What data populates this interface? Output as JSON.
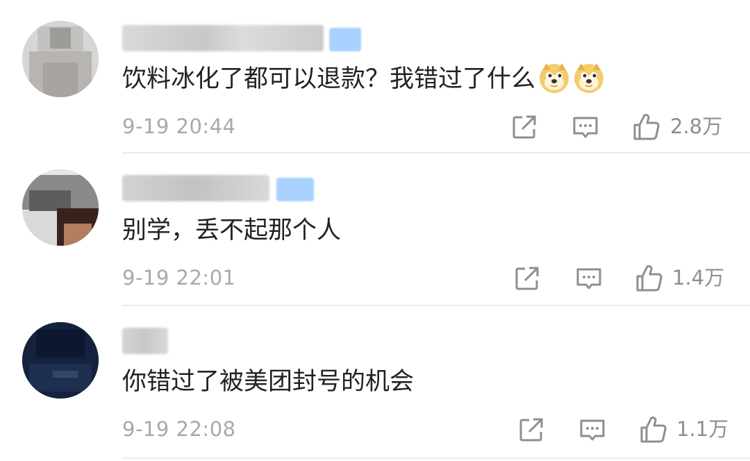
{
  "comments": [
    {
      "text": "饮料冰化了都可以退款？我错过了什么",
      "emoji": [
        "doge-emoji",
        "doge-emoji"
      ],
      "timestamp": "9-19 20:44",
      "likes": "2.8万"
    },
    {
      "text": "别学，丢不起那个人",
      "emoji": [],
      "timestamp": "9-19 22:01",
      "likes": "1.4万"
    },
    {
      "text": "你错过了被美团封号的机会",
      "emoji": [],
      "timestamp": "9-19 22:08",
      "likes": "1.1万"
    }
  ],
  "icons": {
    "share": "share-icon",
    "reply": "reply-icon",
    "like": "thumbs-up-icon"
  },
  "colors": {
    "text": "#222222",
    "meta": "#a9a9a9",
    "icon": "#8e8e8e",
    "divider": "#ececec",
    "badge": "#a9d1ff"
  }
}
